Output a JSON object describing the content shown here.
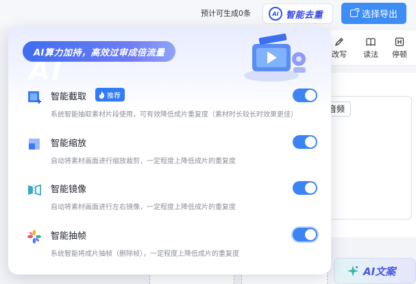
{
  "header": {
    "gen_count": "预计可生成0条",
    "smart_dedup": {
      "badge": "AI",
      "label": "智能去重"
    },
    "export_label": "选择导出"
  },
  "toolbar": {
    "rewrite_label": "改写",
    "read_label": "读法",
    "pause_label": "停顿"
  },
  "editor": {
    "chip_label": "音频",
    "ai_copy_label": "AI文案"
  },
  "popup": {
    "watermark": "AI",
    "banner": "AI算力加持，高效过审成倍流量",
    "recommend_label": "推荐",
    "options": [
      {
        "title": "智能截取",
        "desc": "系统智能抽取素材片段使用，可有效降低成片重复度（素材时长较长时效果更佳）",
        "enabled": true,
        "icon": "crop-icon"
      },
      {
        "title": "智能缩放",
        "desc": "自动将素材画面进行缩放裁剪，一定程度上降低成片的重复度",
        "enabled": true,
        "icon": "zoom-icon"
      },
      {
        "title": "智能镜像",
        "desc": "自动将素材画面进行左右镜像，一定程度上降低成片的重复度",
        "enabled": true,
        "icon": "mirror-icon"
      },
      {
        "title": "智能抽帧",
        "desc": "系统智能将成片抽帧（删除帧），一定程度上降低成片的重复度",
        "enabled": true,
        "icon": "frame-icon"
      }
    ]
  },
  "colors": {
    "accent": "#3a84f5",
    "export_button": "#3d8df7",
    "banner": "#4a6ff3",
    "brand_text": "#3346e8"
  }
}
